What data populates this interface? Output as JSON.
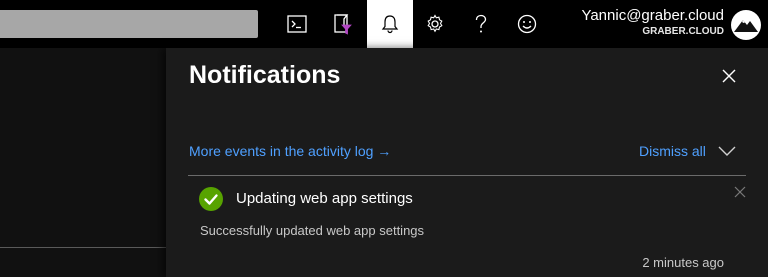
{
  "topbar": {
    "buttons": [
      {
        "icon": "cloud-shell-icon"
      },
      {
        "icon": "directory-filter-icon"
      },
      {
        "icon": "bell-icon",
        "active": true
      },
      {
        "icon": "gear-icon"
      },
      {
        "icon": "help-icon"
      },
      {
        "icon": "smiley-feedback-icon"
      }
    ],
    "user": {
      "name": "Yannic@graber.cloud",
      "tenant": "GRABER.CLOUD"
    }
  },
  "notifications": {
    "title": "Notifications",
    "more_events_link": "More events in the activity log →",
    "dismiss_all_label": "Dismiss all",
    "items": [
      {
        "title": "Updating web app settings",
        "body": "Successfully updated web app settings",
        "time": "2 minutes ago",
        "status": "success",
        "status_color": "#57a300"
      }
    ]
  },
  "colors": {
    "link": "#4fa0ff",
    "topbar_bg": "#000000",
    "panel_bg": "#1b1b1b",
    "active_button_bg": "#ffffff"
  }
}
